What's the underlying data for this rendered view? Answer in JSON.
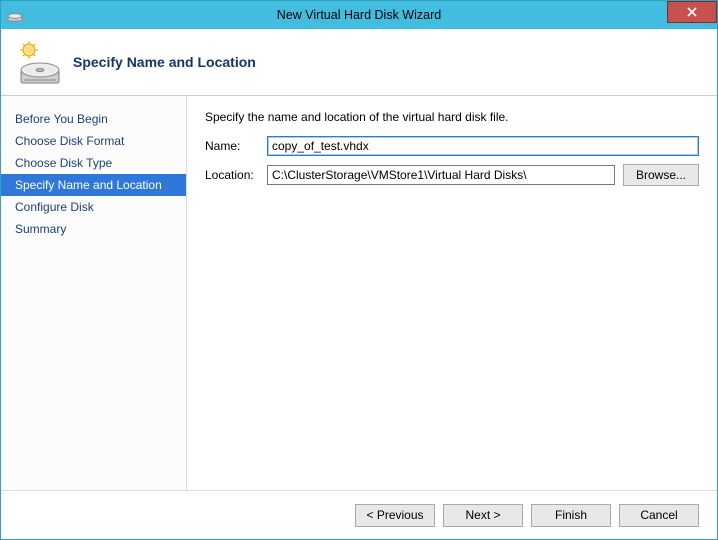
{
  "window": {
    "title": "New Virtual Hard Disk Wizard"
  },
  "header": {
    "heading": "Specify Name and Location"
  },
  "sidebar": {
    "items": [
      {
        "label": "Before You Begin"
      },
      {
        "label": "Choose Disk Format"
      },
      {
        "label": "Choose Disk Type"
      },
      {
        "label": "Specify Name and Location"
      },
      {
        "label": "Configure Disk"
      },
      {
        "label": "Summary"
      }
    ],
    "selected_index": 3
  },
  "main": {
    "instruction": "Specify the name and location of the virtual hard disk file.",
    "name_label": "Name:",
    "name_value": "copy_of_test.vhdx",
    "location_label": "Location:",
    "location_value": "C:\\ClusterStorage\\VMStore1\\Virtual Hard Disks\\",
    "browse_label": "Browse..."
  },
  "footer": {
    "previous": "< Previous",
    "next": "Next >",
    "finish": "Finish",
    "cancel": "Cancel"
  }
}
